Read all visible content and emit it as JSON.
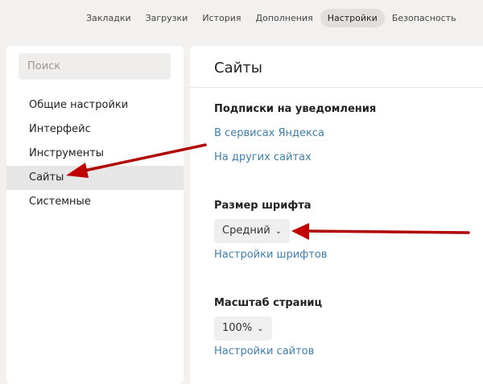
{
  "topnav": {
    "items": [
      "Закладки",
      "Загрузки",
      "История",
      "Дополнения",
      "Настройки",
      "Безопасность"
    ],
    "active": "Настройки"
  },
  "sidebar": {
    "search_placeholder": "Поиск",
    "items": [
      "Общие настройки",
      "Интерфейс",
      "Инструменты",
      "Сайты",
      "Системные"
    ],
    "selected": "Сайты"
  },
  "main": {
    "title": "Сайты",
    "notifications": {
      "heading": "Подписки на уведомления",
      "links": [
        "В сервисах Яндекса",
        "На других сайтах"
      ]
    },
    "font_size": {
      "heading": "Размер шрифта",
      "value": "Средний",
      "link": "Настройки шрифтов"
    },
    "page_zoom": {
      "heading": "Масштаб страниц",
      "value": "100%",
      "link": "Настройки сайтов"
    }
  },
  "colors": {
    "link": "#3c7fb1",
    "annotation_arrow": "#c00000"
  }
}
